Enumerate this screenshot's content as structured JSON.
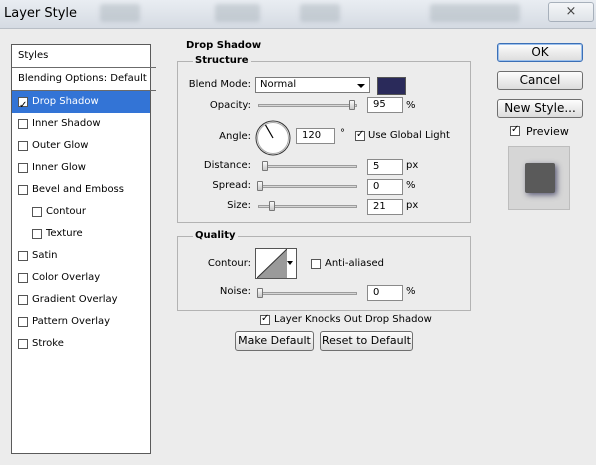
{
  "window": {
    "title": "Layer Style",
    "close_icon": "×"
  },
  "sidebar": {
    "header": "Styles",
    "blending": "Blending Options: Default",
    "items": [
      {
        "label": "Drop Shadow",
        "checked": true,
        "selected": true
      },
      {
        "label": "Inner Shadow",
        "checked": false
      },
      {
        "label": "Outer Glow",
        "checked": false
      },
      {
        "label": "Inner Glow",
        "checked": false
      },
      {
        "label": "Bevel and Emboss",
        "checked": false
      },
      {
        "label": "Contour",
        "checked": false
      },
      {
        "label": "Texture",
        "checked": false
      },
      {
        "label": "Satin",
        "checked": false
      },
      {
        "label": "Color Overlay",
        "checked": false
      },
      {
        "label": "Gradient Overlay",
        "checked": false
      },
      {
        "label": "Pattern Overlay",
        "checked": false
      },
      {
        "label": "Stroke",
        "checked": false
      }
    ]
  },
  "drop_shadow": {
    "section_title": "Drop Shadow",
    "structure_title": "Structure",
    "blend_mode_label": "Blend Mode:",
    "blend_mode_value": "Normal",
    "shadow_color": "#2a2a5a",
    "opacity_label": "Opacity:",
    "opacity_value": "95",
    "opacity_unit": "%",
    "angle_label": "Angle:",
    "angle_value": "120",
    "angle_unit": "°",
    "global_light_label": "Use Global Light",
    "global_light_checked": true,
    "distance_label": "Distance:",
    "distance_value": "5",
    "distance_unit": "px",
    "spread_label": "Spread:",
    "spread_value": "0",
    "spread_unit": "%",
    "size_label": "Size:",
    "size_value": "21",
    "size_unit": "px",
    "quality_title": "Quality",
    "contour_label": "Contour:",
    "anti_aliased_label": "Anti-aliased",
    "anti_aliased_checked": false,
    "noise_label": "Noise:",
    "noise_value": "0",
    "noise_unit": "%",
    "knockout_label": "Layer Knocks Out Drop Shadow",
    "knockout_checked": true,
    "make_default_label": "Make Default",
    "reset_default_label": "Reset to Default"
  },
  "actions": {
    "ok_label": "OK",
    "cancel_label": "Cancel",
    "new_style_label": "New Style...",
    "preview_label": "Preview",
    "preview_checked": true
  },
  "colors": {
    "selection": "#3374d6",
    "shadow": "#2a2a5a",
    "preview_swatch": "#5a5a5a"
  }
}
